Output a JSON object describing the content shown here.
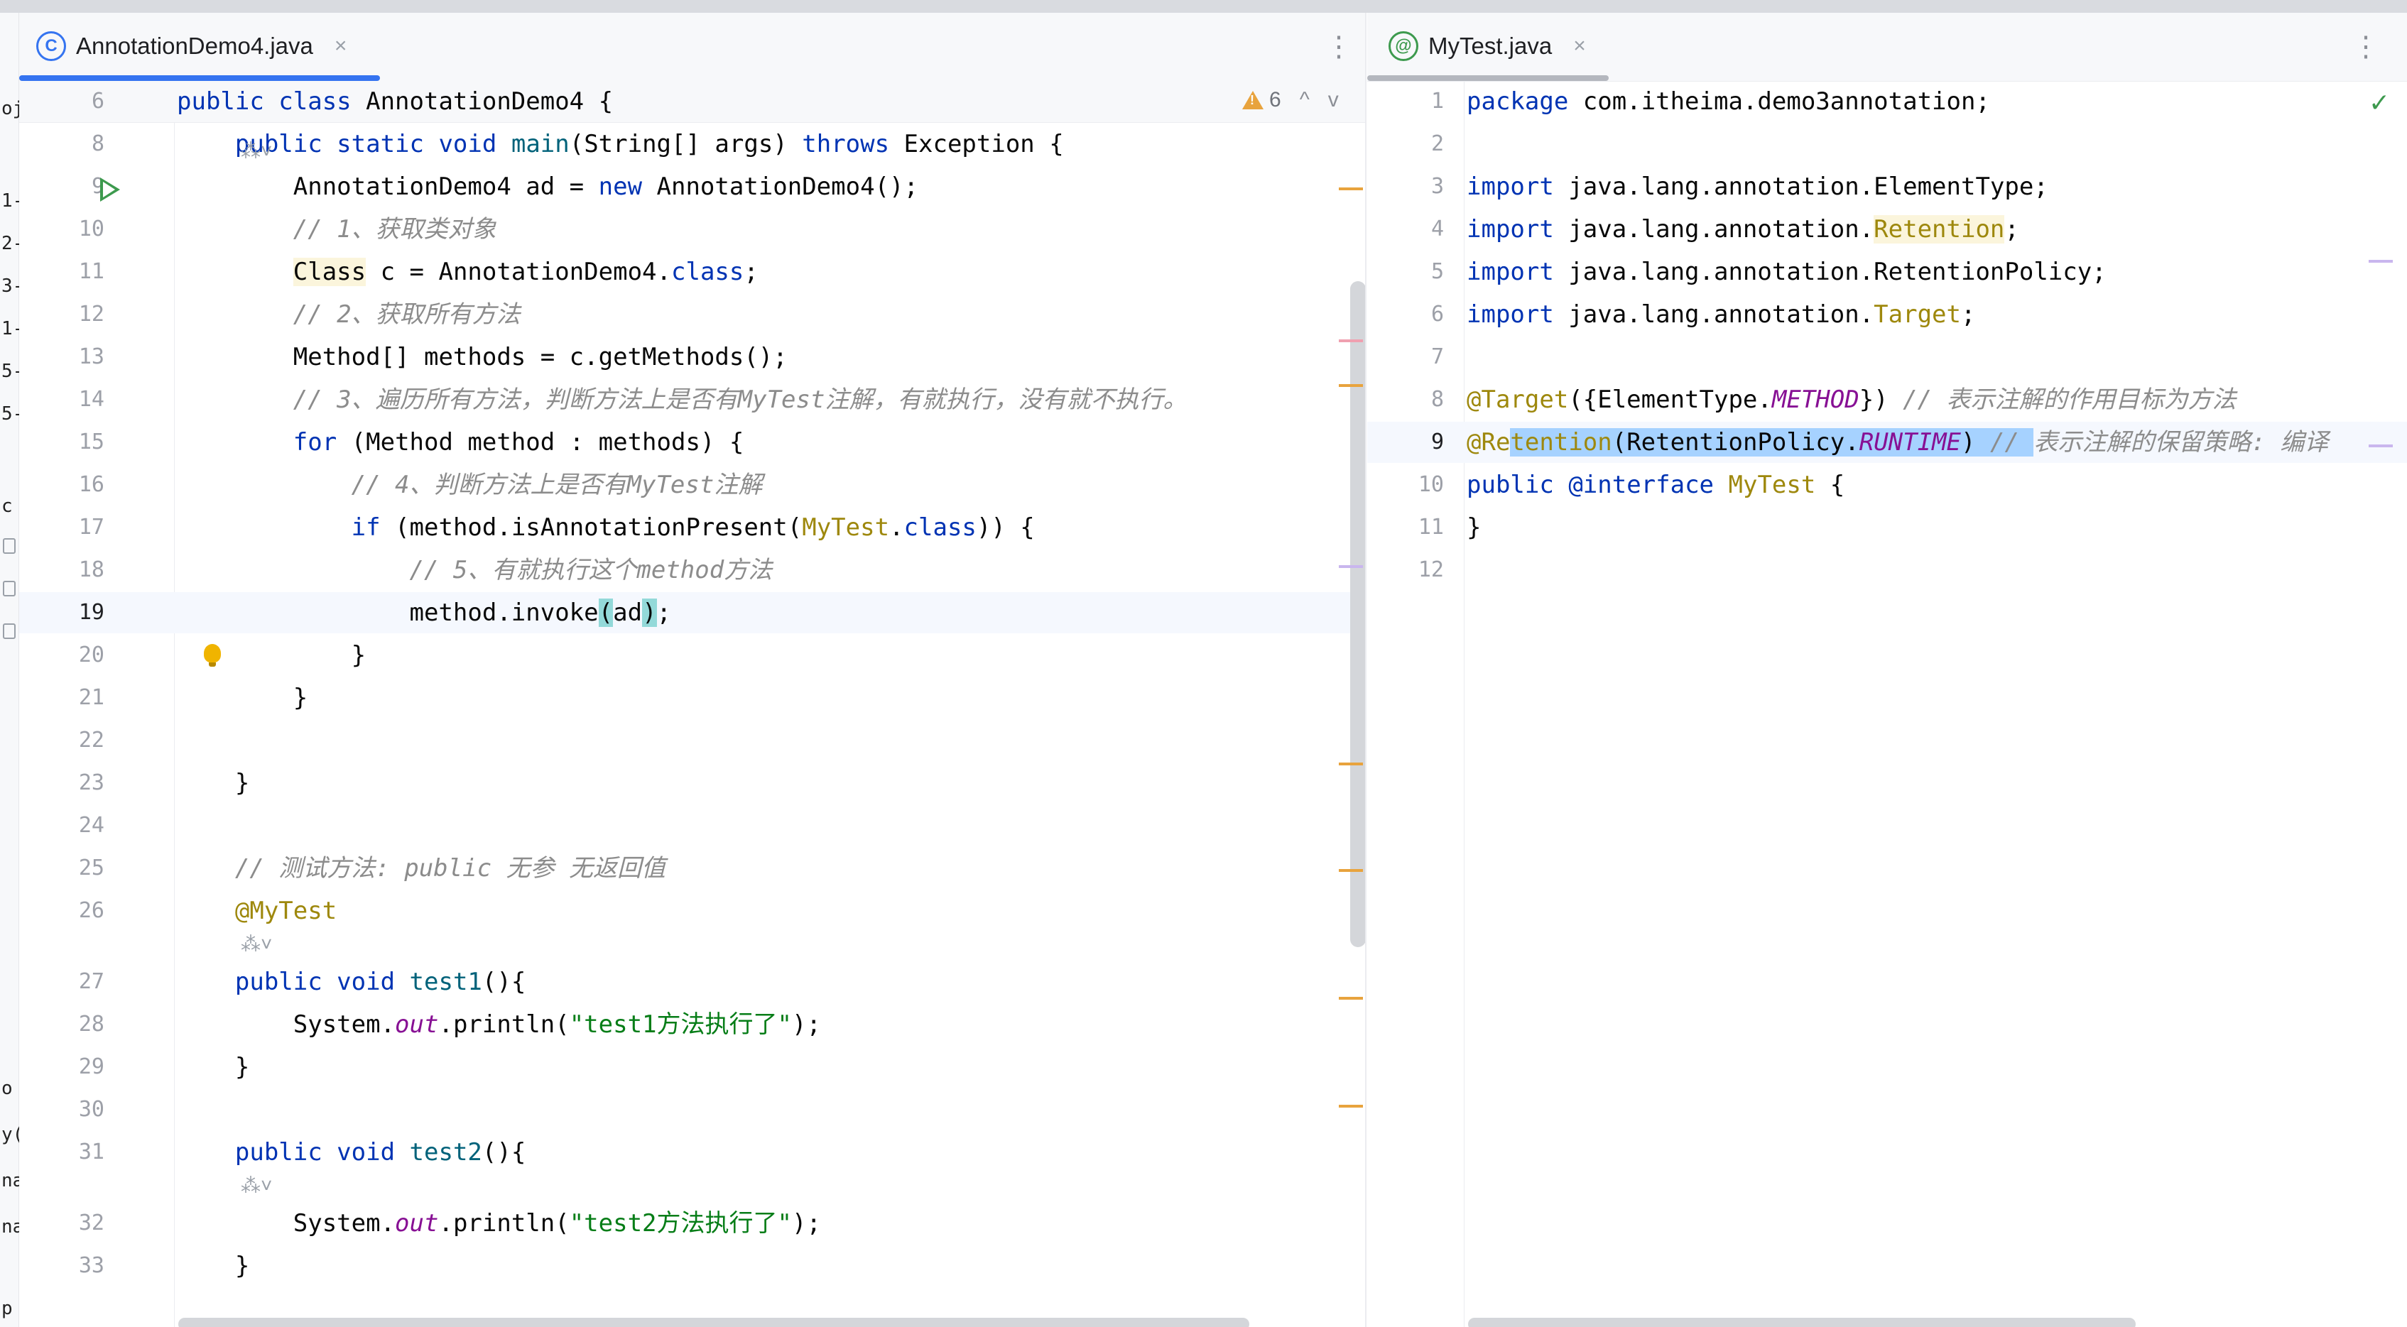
{
  "left_tab": {
    "title": "AnnotationDemo4.java",
    "close": "×"
  },
  "right_tab": {
    "title": "MyTest.java",
    "close": "×"
  },
  "kebab": "⋮",
  "warnings": {
    "count": "6",
    "up": "^",
    "down": "v"
  },
  "hint_icon": "⁂˅",
  "colors": {
    "accent": "#3574f0",
    "warning": "#e8a33d",
    "run": "#3d9a4e",
    "selection": "#a6d2ff"
  },
  "left_lines": [
    {
      "n": "6",
      "html": "<span class=\"kw\">public class</span> AnnotationDemo4 {"
    },
    {
      "n": "8",
      "html": "    <span class=\"kw\">public static void</span> <span class=\"fn\">main</span>(String[] args) <span class=\"kw\">throws</span> Exception {"
    },
    {
      "n": "9",
      "html": "        AnnotationDemo4 ad = <span class=\"kw\">new</span> AnnotationDemo4();"
    },
    {
      "n": "10",
      "html": "        <span class=\"cmt\">// 1、获取类对象</span>"
    },
    {
      "n": "11",
      "html": "        <span class=\"class-hl\">Class</span> c = AnnotationDemo4.<span class=\"kw\">class</span>;"
    },
    {
      "n": "12",
      "html": "        <span class=\"cmt\">// 2、获取所有方法</span>"
    },
    {
      "n": "13",
      "html": "        Method[] methods = c.getMethods();"
    },
    {
      "n": "14",
      "html": "        <span class=\"cmt\">// 3、遍历所有方法，判断方法上是否有MyTest注解，有就执行，没有就不执行。</span>"
    },
    {
      "n": "15",
      "html": "        <span class=\"kw\">for</span> (Method method : methods) {"
    },
    {
      "n": "16",
      "html": "            <span class=\"cmt\">// 4、判断方法上是否有MyTest注解</span>"
    },
    {
      "n": "17",
      "html": "            <span class=\"kw\">if</span> (method.isAnnotationPresent(<span class=\"ann\">MyTest</span>.<span class=\"kw\">class</span>)) {"
    },
    {
      "n": "18",
      "html": "                <span class=\"cmt\">// 5、有就执行这个method方法</span>"
    },
    {
      "n": "19",
      "html": "                method.invoke<span class=\"brace-hl\">(</span>ad<span class=\"brace-hl\">)</span>;"
    },
    {
      "n": "20",
      "html": "            }"
    },
    {
      "n": "21",
      "html": "        }"
    },
    {
      "n": "22",
      "html": ""
    },
    {
      "n": "23",
      "html": "    }"
    },
    {
      "n": "24",
      "html": ""
    },
    {
      "n": "25",
      "html": "    <span class=\"cmt\">// 测试方法: public 无参 无返回值</span>"
    },
    {
      "n": "26",
      "html": "    <span class=\"ann\">@MyTest</span>"
    },
    {
      "n": "27",
      "html": "    <span class=\"kw\">public void</span> <span class=\"fn\">test1</span>(){"
    },
    {
      "n": "28",
      "html": "        System.<span class=\"fld\">out</span>.println(<span class=\"str\">\"test1方法执行了\"</span>);"
    },
    {
      "n": "29",
      "html": "    }"
    },
    {
      "n": "30",
      "html": ""
    },
    {
      "n": "31",
      "html": "    <span class=\"kw\">public void</span> <span class=\"fn\">test2</span>(){"
    },
    {
      "n": "32",
      "html": "        System.<span class=\"fld\">out</span>.println(<span class=\"str\">\"test2方法执行了\"</span>);"
    },
    {
      "n": "33",
      "html": "    }"
    }
  ],
  "right_lines": [
    {
      "n": "1",
      "html": "<span class=\"kw\">package</span> com.itheima.demo3annotation;"
    },
    {
      "n": "2",
      "html": ""
    },
    {
      "n": "3",
      "html": "<span class=\"kw\">import</span> java.lang.annotation.ElementType;"
    },
    {
      "n": "4",
      "html": "<span class=\"kw\">import</span> java.lang.annotation.<span class=\"ann class-hl\">Retention</span>;"
    },
    {
      "n": "5",
      "html": "<span class=\"kw\">import</span> java.lang.annotation.RetentionPolicy;"
    },
    {
      "n": "6",
      "html": "<span class=\"kw\">import</span> java.lang.annotation.<span class=\"ann\">Target</span>;"
    },
    {
      "n": "7",
      "html": ""
    },
    {
      "n": "8",
      "html": "<span class=\"ann\">@Target</span>({ElementType.<span class=\"fld\">METHOD</span>}) <span class=\"cmt\">// 表示注解的作用目标为方法</span>"
    },
    {
      "n": "9",
      "html": "<span class=\"ann\">@Re</span><span class=\"sel\"><span class=\"ann\">tention</span>(RetentionPolicy.<span class=\"fld\">RUNTIME</span>) <span class=\"cmt\">// </span></span><span class=\"cmt\">表示注解的保留策略: 编译</span>"
    },
    {
      "n": "10",
      "html": "<span class=\"kw\">public</span> <span class=\"kw\">@interface</span> <span class=\"ann\">MyTest</span> {"
    },
    {
      "n": "11",
      "html": "}"
    },
    {
      "n": "12",
      "html": ""
    }
  ],
  "sidebar_fragments": [
    "oj",
    "1-",
    "2-",
    "3-",
    "1-",
    "5-",
    "5-",
    "c",
    "o",
    "y(",
    "na",
    "na",
    "p"
  ]
}
